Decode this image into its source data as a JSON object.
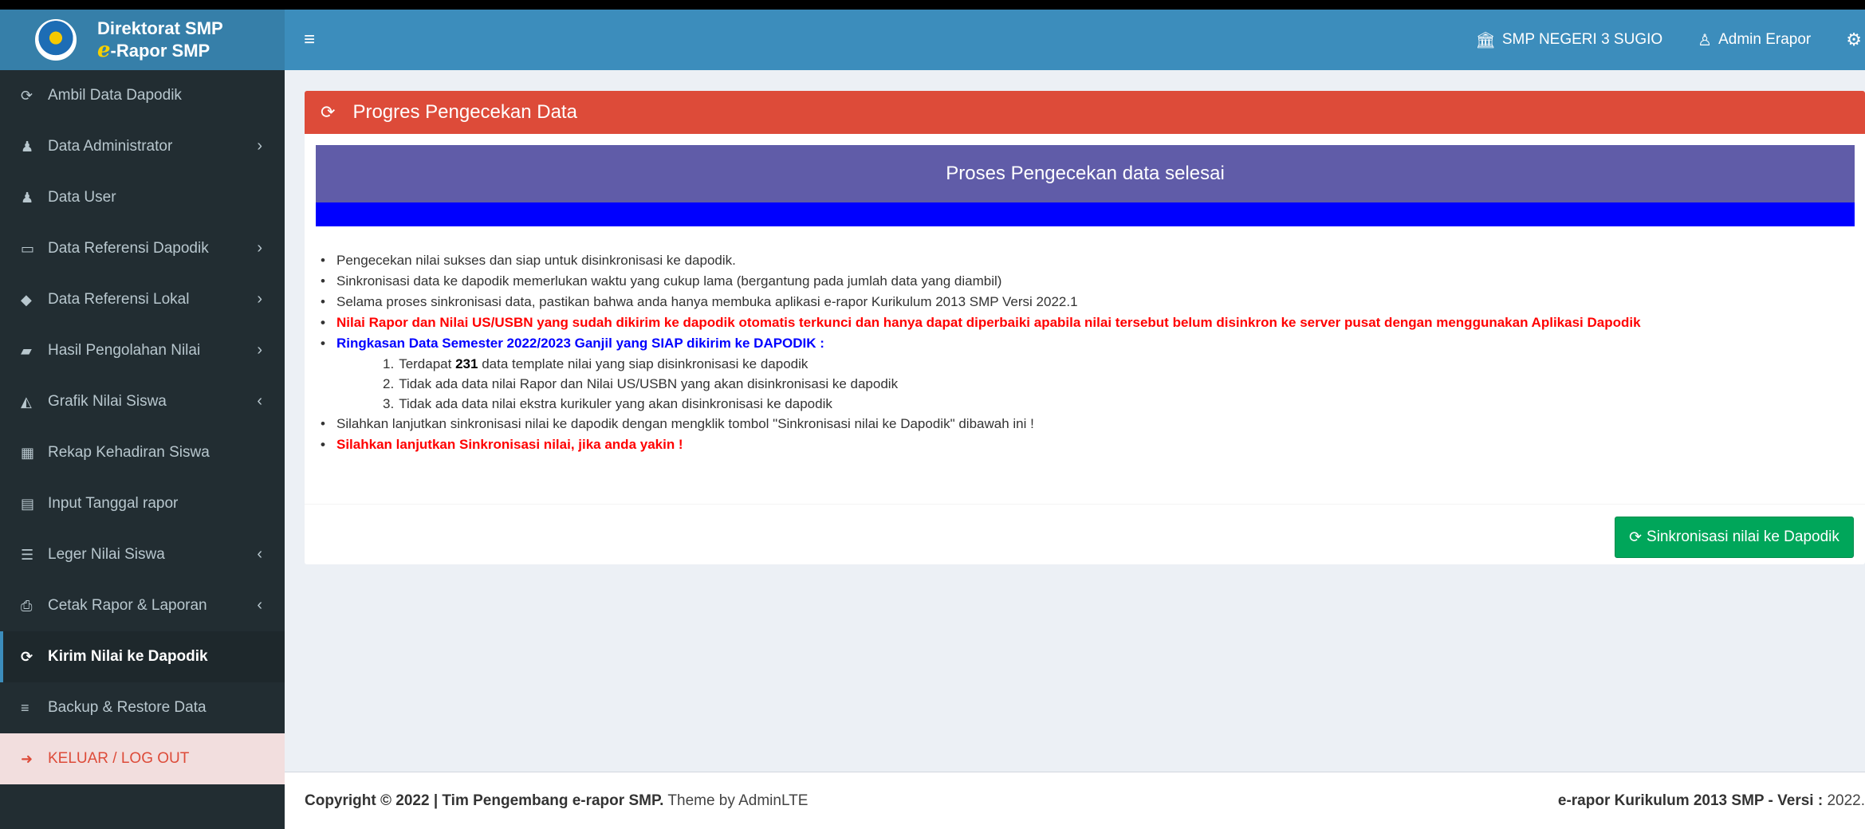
{
  "brand": {
    "title_line1": "Direktorat SMP",
    "title_e": "e",
    "title_line2": "-Rapor SMP"
  },
  "navbar": {
    "toggle_icon": "hamburger-icon",
    "school": "SMP NEGERI 3 SUGIO",
    "user": "Admin Erapor"
  },
  "sidebar": {
    "items": [
      {
        "label": "Ambil Data Dapodik",
        "icon": "refresh-icon",
        "arrow": ""
      },
      {
        "label": "Data Administrator",
        "icon": "users-icon",
        "arrow": "›"
      },
      {
        "label": "Data User",
        "icon": "users-icon",
        "arrow": ""
      },
      {
        "label": "Data Referensi Dapodik",
        "icon": "monitor-icon",
        "arrow": "›"
      },
      {
        "label": "Data Referensi Lokal",
        "icon": "tags-icon",
        "arrow": "›"
      },
      {
        "label": "Hasil Pengolahan Nilai",
        "icon": "book-icon",
        "arrow": "›"
      },
      {
        "label": "Grafik Nilai Siswa",
        "icon": "area-chart-icon",
        "arrow": "‹"
      },
      {
        "label": "Rekap Kehadiran Siswa",
        "icon": "calculator-icon",
        "arrow": ""
      },
      {
        "label": "Input Tanggal rapor",
        "icon": "calendar-icon",
        "arrow": ""
      },
      {
        "label": "Leger Nilai Siswa",
        "icon": "list-icon",
        "arrow": "‹"
      },
      {
        "label": "Cetak Rapor & Laporan",
        "icon": "print-icon",
        "arrow": "‹"
      },
      {
        "label": "Kirim Nilai ke Dapodik",
        "icon": "refresh-icon",
        "arrow": ""
      },
      {
        "label": "Backup & Restore Data",
        "icon": "database-icon",
        "arrow": ""
      },
      {
        "label": "KELUAR / LOG OUT",
        "icon": "sign-out-icon",
        "arrow": ""
      }
    ]
  },
  "box": {
    "title": "Progres Pengecekan Data",
    "progress_message": "Proses Pengecekan data selesai",
    "progress_percent": 100,
    "notes": [
      "Pengecekan nilai sukses dan siap untuk disinkronisasi ke dapodik.",
      "Sinkronisasi data ke dapodik memerlukan waktu yang cukup lama (bergantung pada jumlah data yang diambil)",
      "Selama proses sinkronisasi data, pastikan bahwa anda hanya membuka aplikasi e-rapor Kurikulum 2013 SMP Versi 2022.1",
      "Nilai Rapor dan Nilai US/USBN yang sudah dikirim ke dapodik otomatis terkunci dan hanya dapat diperbaiki apabila nilai tersebut belum disinkron ke server pusat dengan menggunakan Aplikasi Dapodik",
      "Ringkasan Data Semester 2022/2023 Ganjil yang SIAP dikirim ke DAPODIK :"
    ],
    "summary": {
      "item1_prefix": "Terdapat",
      "item1_count": "231",
      "item1_suffix": "data template nilai yang siap disinkronisasi ke dapodik",
      "item2": "Tidak ada data nilai Rapor dan Nilai US/USBN yang akan disinkronisasi ke dapodik",
      "item3": "Tidak ada data nilai ekstra kurikuler yang akan disinkronisasi ke dapodik"
    },
    "notes_after": [
      "Silahkan lanjutkan sinkronisasi nilai ke dapodik dengan mengklik tombol \"Sinkronisasi nilai ke Dapodik\" dibawah ini !",
      "Silahkan lanjutkan Sinkronisasi nilai, jika anda yakin !"
    ],
    "sync_button": "Sinkronisasi nilai ke Dapodik"
  },
  "footer": {
    "copyright_prefix": "Copyright © 2022 | Tim Pengembang e-rapor SMP.",
    "theme": "Theme by AdminLTE",
    "right_label": "e-rapor Kurikulum 2013 SMP - Versi :",
    "version": "2022."
  },
  "colors": {
    "navbar": "#3c8dbc",
    "brand": "#367fa9",
    "sidebar": "#222d32",
    "box_header": "#dd4b39",
    "progress_message": "#605ca8",
    "progress_bar": "#0000ff",
    "sync_button": "#00a65a",
    "warning_text": "#ff0000",
    "summary_text": "#0000ff"
  }
}
